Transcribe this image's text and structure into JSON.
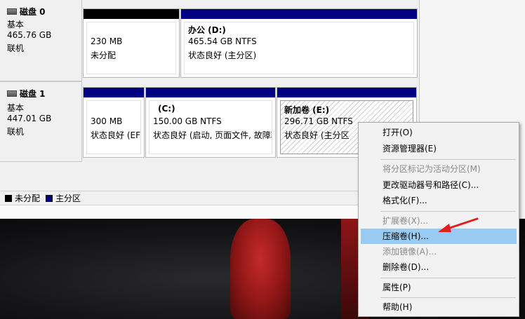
{
  "disks": [
    {
      "name": "磁盘 0",
      "type": "基本",
      "size": "465.76 GB",
      "status": "联机",
      "partitions": [
        {
          "title": "",
          "line1": "230 MB",
          "line2": "未分配",
          "bar_color": "#000000"
        },
        {
          "title": "办公  (D:)",
          "line1": "465.54 GB NTFS",
          "line2": "状态良好 (主分区)",
          "bar_color": "#000080"
        }
      ]
    },
    {
      "name": "磁盘 1",
      "type": "基本",
      "size": "447.01 GB",
      "status": "联机",
      "partitions": [
        {
          "title": "",
          "line1": "300 MB",
          "line2": "状态良好 (EFI",
          "bar_color": "#000080"
        },
        {
          "title": "(C:)",
          "line1": "150.00 GB NTFS",
          "line2": "状态良好 (启动, 页面文件, 故障转",
          "bar_color": "#000080"
        },
        {
          "title": "新加卷  (E:)",
          "line1": "296.71 GB NTFS",
          "line2": "状态良好 (主分区",
          "bar_color": "#000080"
        }
      ]
    }
  ],
  "legend": [
    {
      "label": "未分配",
      "color": "#000000"
    },
    {
      "label": "主分区",
      "color": "#000080"
    }
  ],
  "context_menu": {
    "items": [
      {
        "label": "打开(O)",
        "disabled": false,
        "highlighted": false
      },
      {
        "label": "资源管理器(E)",
        "disabled": false,
        "highlighted": false
      },
      {
        "label": "将分区标记为活动分区(M)",
        "disabled": true,
        "highlighted": false
      },
      {
        "label": "更改驱动器号和路径(C)...",
        "disabled": false,
        "highlighted": false
      },
      {
        "label": "格式化(F)...",
        "disabled": false,
        "highlighted": false
      },
      {
        "label": "扩展卷(X)...",
        "disabled": true,
        "highlighted": false
      },
      {
        "label": "压缩卷(H)...",
        "disabled": false,
        "highlighted": true
      },
      {
        "label": "添加镜像(A)...",
        "disabled": true,
        "highlighted": false
      },
      {
        "label": "删除卷(D)...",
        "disabled": false,
        "highlighted": false
      },
      {
        "label": "属性(P)",
        "disabled": false,
        "highlighted": false
      },
      {
        "label": "帮助(H)",
        "disabled": false,
        "highlighted": false
      }
    ]
  },
  "annotation": {
    "color": "#e02020",
    "icon": "arrow-icon"
  },
  "colors": {
    "highlight": "#99cbf2",
    "primary_partition": "#000080",
    "unallocated": "#000000"
  }
}
